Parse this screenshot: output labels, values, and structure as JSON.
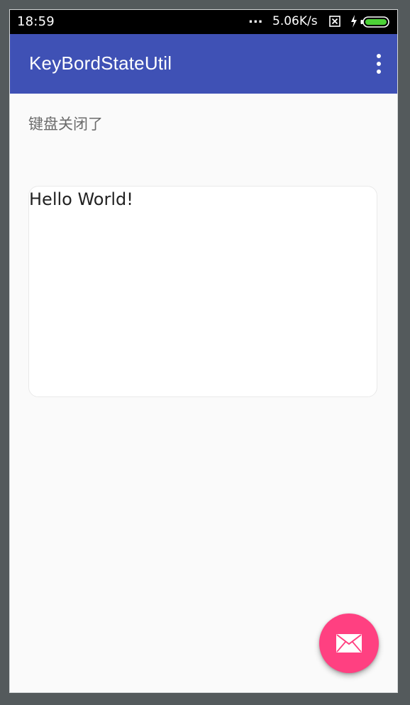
{
  "status_bar": {
    "time": "18:59",
    "dots": "...",
    "network_speed": "5.06K/s",
    "icons": [
      "sim-x-icon",
      "charging-bolt-icon",
      "battery-icon"
    ]
  },
  "app_bar": {
    "title": "KeyBordStateUtil",
    "background_color": "#3f51b5",
    "menu_icon": "more-vert-icon"
  },
  "content": {
    "keyboard_status": "键盘关闭了",
    "text_input_value": "Hello World!"
  },
  "fab": {
    "icon": "email-icon",
    "color": "#ff4081"
  }
}
